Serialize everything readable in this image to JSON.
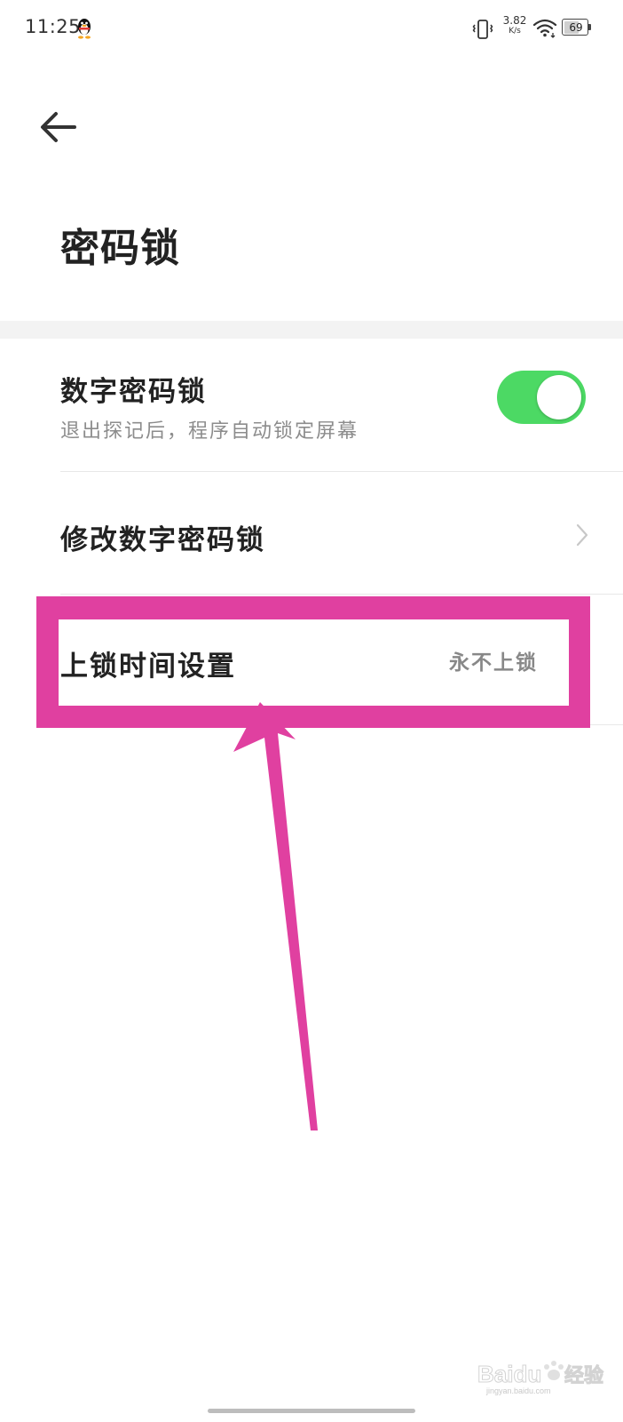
{
  "status_bar": {
    "time": "11:25",
    "net_speed_value": "3.82",
    "net_speed_unit": "K/s",
    "battery_level": "69",
    "battery_fraction": 0.69
  },
  "header": {
    "title": "密码锁",
    "back_icon": "arrow-left-icon"
  },
  "settings": {
    "items": [
      {
        "title": "数字密码锁",
        "subtitle": "退出探记后，程序自动锁定屏幕",
        "control": "toggle",
        "enabled": true
      },
      {
        "title": "修改数字密码锁",
        "control": "chevron-right-icon"
      },
      {
        "title": "上锁时间设置",
        "value": "永不上锁"
      }
    ]
  },
  "colors": {
    "toggle_on": "#4cd964",
    "annotation": "#e040a0",
    "text_primary": "#222222",
    "text_secondary": "#8c8c8c"
  },
  "watermark": {
    "brand": "Baidu",
    "service": "经验",
    "url": "jingyan.baidu.com"
  }
}
